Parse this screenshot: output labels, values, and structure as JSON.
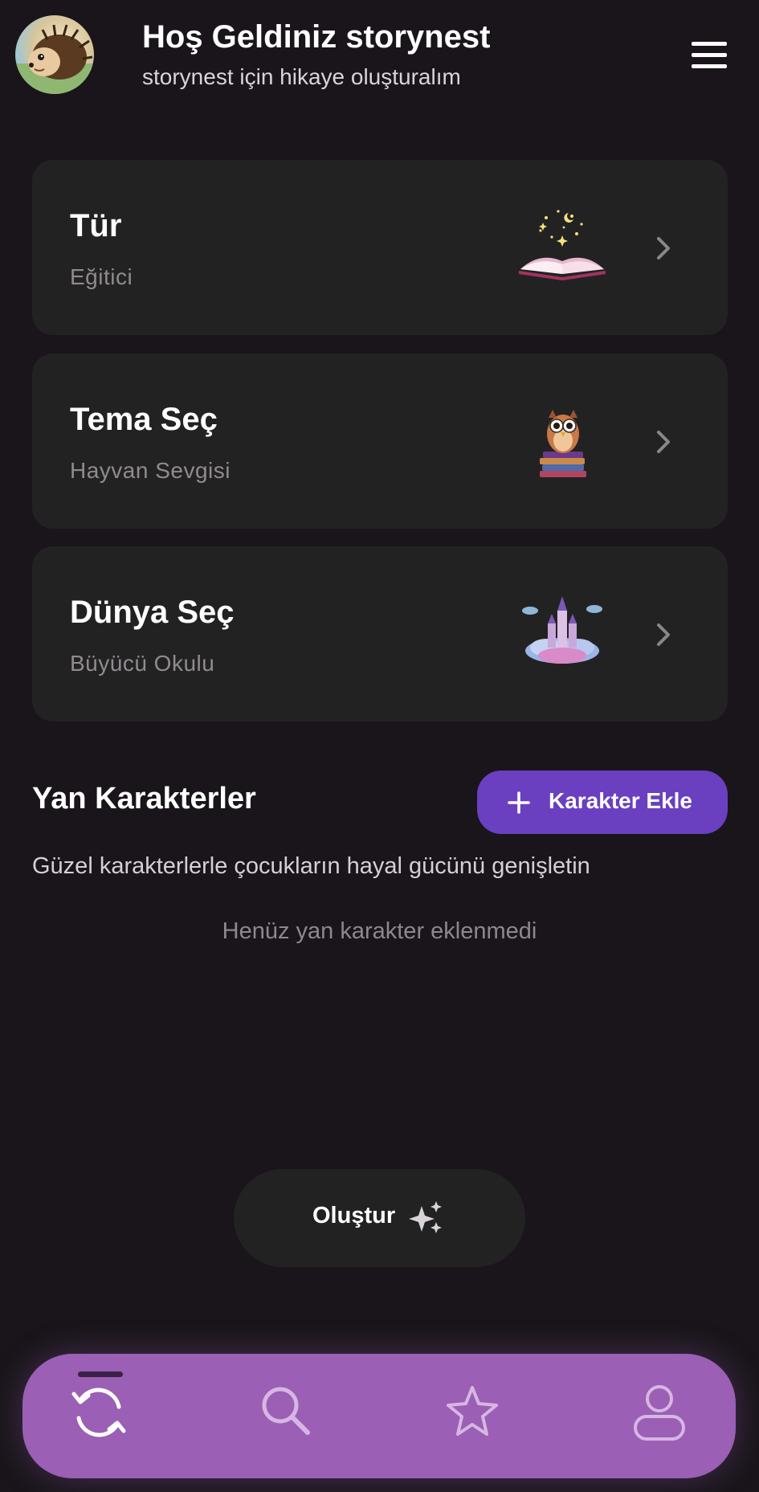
{
  "header": {
    "title": "Hoş Geldiniz storynest",
    "subtitle": "storynest için hikaye oluşturalım"
  },
  "cards": [
    {
      "title": "Tür",
      "subtitle": "Eğitici",
      "icon": "open-book-illustration"
    },
    {
      "title": "Tema Seç",
      "subtitle": "Hayvan Sevgisi",
      "icon": "owl-on-books-illustration"
    },
    {
      "title": "Dünya Seç",
      "subtitle": "Büyücü Okulu",
      "icon": "floating-castle-illustration"
    }
  ],
  "side_characters": {
    "title": "Yan Karakterler",
    "add_button_label": "Karakter Ekle",
    "description": "Güzel karakterlerle çocukların hayal gücünü genişletin",
    "empty_text": "Henüz yan karakter eklenmedi"
  },
  "create_button": {
    "label": "Oluştur",
    "icon": "sparkle-icon"
  },
  "bottom_nav": {
    "items": [
      {
        "icon": "refresh-icon",
        "active": true
      },
      {
        "icon": "search-icon",
        "active": false
      },
      {
        "icon": "star-icon",
        "active": false
      },
      {
        "icon": "user-icon",
        "active": false
      }
    ]
  },
  "colors": {
    "background": "#19151a",
    "card": "#232223",
    "accent": "#6a3fc0",
    "nav": "#9b5fb5"
  }
}
